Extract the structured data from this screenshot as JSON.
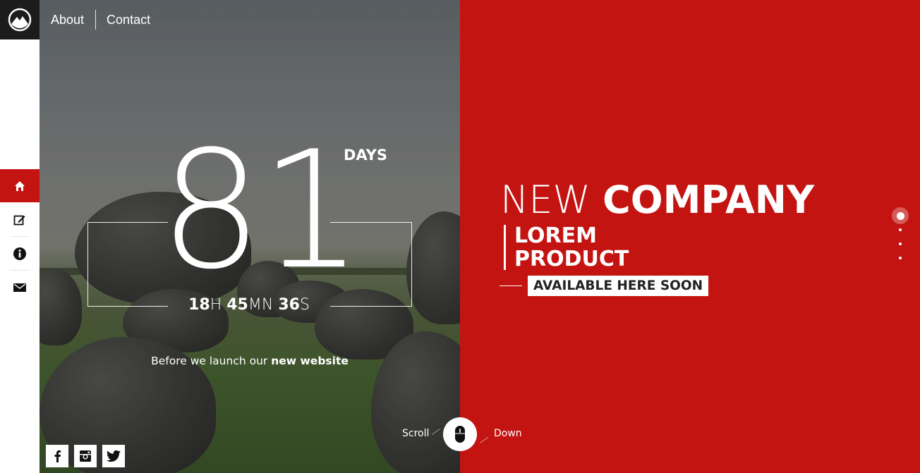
{
  "nav": {
    "items": [
      "About",
      "Contact"
    ]
  },
  "sidebar": {
    "items": [
      "home-icon",
      "edit-icon",
      "info-icon",
      "mail-icon"
    ],
    "active": "home-icon"
  },
  "countdown": {
    "days": "81",
    "days_label": "DAYS",
    "hours": "18",
    "hours_unit": "H",
    "minutes": "45",
    "minutes_unit": "MN",
    "seconds": "36",
    "seconds_unit": "S"
  },
  "tagline": {
    "prefix": "Before we launch our",
    "bold": "new website"
  },
  "headline": {
    "light": "NEW",
    "bold": "COMPANY"
  },
  "subheadline": {
    "line1": "LOREM",
    "line2": "PRODUCT"
  },
  "availability": "AVAILABLE HERE SOON",
  "scroll": {
    "left": "Scroll",
    "right": "Down"
  },
  "social": [
    "facebook-icon",
    "instagram-icon",
    "twitter-icon"
  ],
  "pager": {
    "total": 4,
    "active_index": 0
  },
  "colors": {
    "accent": "#c41411",
    "logo_bg": "#1c1c1c"
  }
}
